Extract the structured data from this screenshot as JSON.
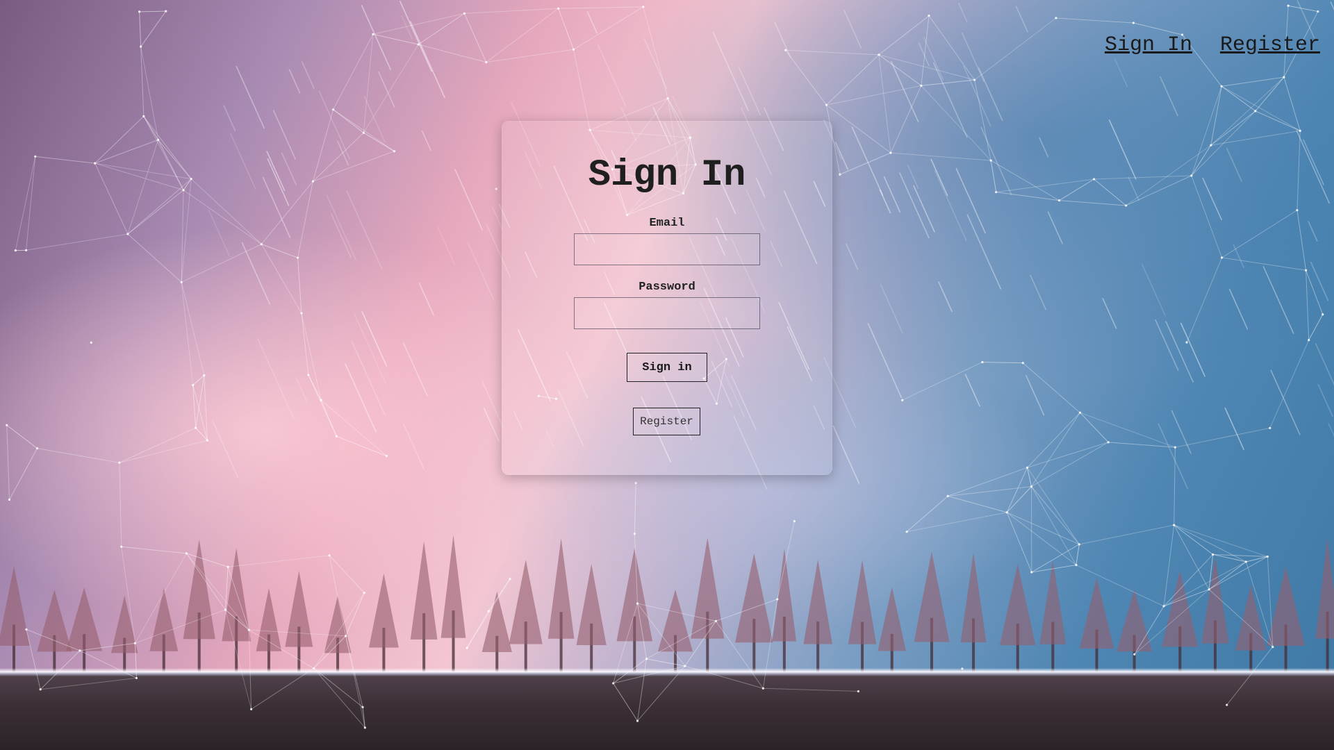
{
  "nav": {
    "signin_label": "Sign In",
    "register_label": "Register"
  },
  "form": {
    "title": "Sign In",
    "email_label": "Email",
    "email_value": "",
    "password_label": "Password",
    "password_value": "",
    "signin_button": "Sign in",
    "register_button": "Register"
  },
  "colors": {
    "text": "#1a1a1a",
    "sky_pink": "#f3c6d2",
    "sky_blue": "#3e78a5"
  }
}
